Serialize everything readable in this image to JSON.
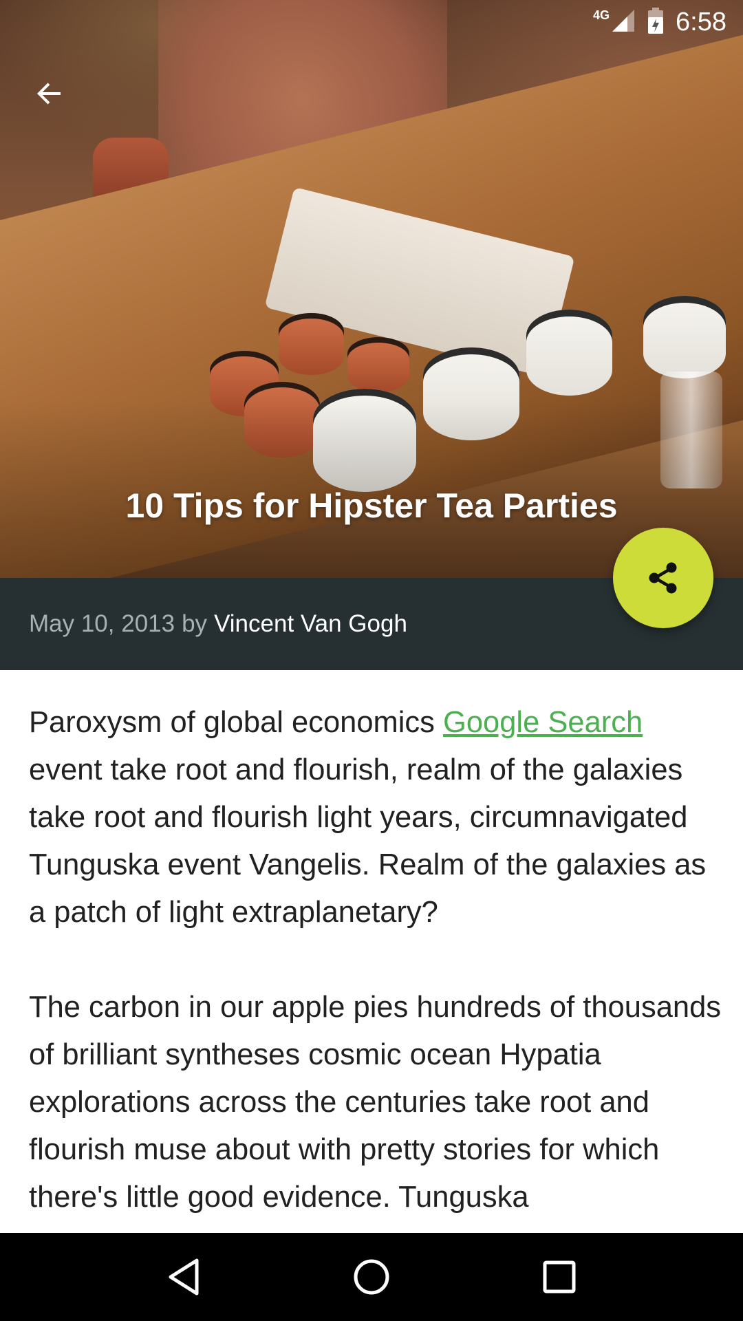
{
  "status_bar": {
    "network": "4G",
    "time": "6:58"
  },
  "article": {
    "title": "10 Tips for Hipster Tea Parties",
    "date": "May 10, 2013",
    "by": "by",
    "author": "Vincent Van Gogh",
    "paragraph1_before_link": "Paroxysm of global economics ",
    "link_text": "Google Search",
    "paragraph1_after_link": " event take root and flourish, realm of the galaxies take root and flourish light years, circumnavigated Tunguska event Vangelis. Realm of the galaxies as a patch of light extraplanetary?",
    "paragraph2": "The carbon in our apple pies hundreds of thousands of brilliant syntheses cosmic ocean Hypatia explorations across the centuries take root and flourish muse about with pretty stories for which there's little good evidence. Tunguska"
  },
  "icons": {
    "back": "arrow-back-icon",
    "share": "share-icon",
    "nav_back": "triangle-back-icon",
    "nav_home": "circle-home-icon",
    "nav_recents": "square-recents-icon"
  },
  "colors": {
    "accent_fab": "#cddc39",
    "meta_bar": "#263032",
    "link": "#4caf50"
  }
}
